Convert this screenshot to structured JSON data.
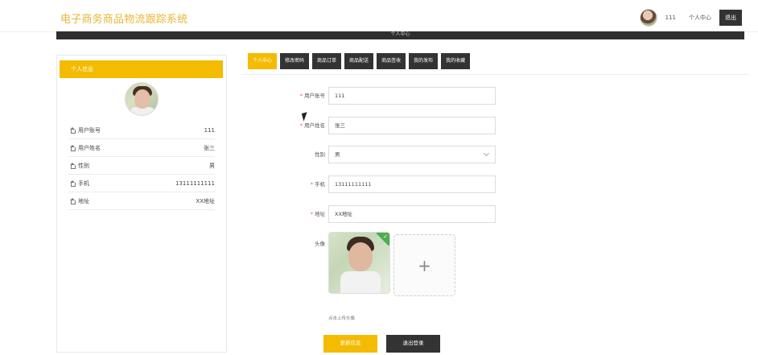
{
  "header": {
    "site_title": "电子商务商品物流跟踪系统",
    "username": "111",
    "personal_center": "个人中心",
    "logout": "退出",
    "banner_text": "个人中心"
  },
  "left_panel": {
    "title": "个人信息",
    "items": [
      {
        "label": "用户账号",
        "value": "111",
        "icon": "home-icon"
      },
      {
        "label": "用户姓名",
        "value": "张三",
        "icon": "home-icon"
      },
      {
        "label": "性别",
        "value": "男",
        "icon": "home-icon"
      },
      {
        "label": "手机",
        "value": "13111111111",
        "icon": "home-icon"
      },
      {
        "label": "地址",
        "value": "XX地址",
        "icon": "home-icon"
      }
    ]
  },
  "tabs": [
    {
      "label": "个人中心",
      "active": true
    },
    {
      "label": "修改密码",
      "active": false
    },
    {
      "label": "商品订单",
      "active": false
    },
    {
      "label": "商品配送",
      "active": false
    },
    {
      "label": "商品签收",
      "active": false
    },
    {
      "label": "我的发布",
      "active": false
    },
    {
      "label": "我的收藏",
      "active": false
    }
  ],
  "form": {
    "account": {
      "label": "用户账号",
      "required": true,
      "value": "111"
    },
    "name": {
      "label": "用户姓名",
      "required": true,
      "value": "张三"
    },
    "gender": {
      "label": "性别",
      "required": false,
      "value": "男"
    },
    "phone": {
      "label": "手机",
      "required": true,
      "value": "13111111111"
    },
    "address": {
      "label": "地址",
      "required": true,
      "value": "XX地址"
    },
    "avatar": {
      "label": "头像",
      "tip": "点击上传头像"
    },
    "update_button": "更新信息",
    "logout_button": "退出登录"
  },
  "colors": {
    "accent": "#f4bb00",
    "dark": "#333333"
  }
}
